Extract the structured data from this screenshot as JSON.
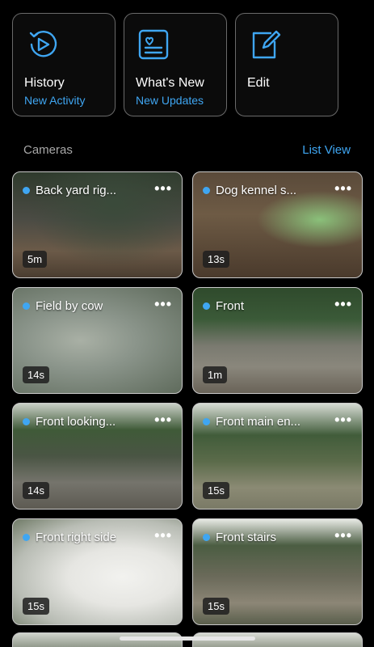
{
  "tiles": [
    {
      "title": "History",
      "subtitle": "New Activity",
      "icon": "history-play-icon"
    },
    {
      "title": "What's New",
      "subtitle": "New Updates",
      "icon": "news-card-icon"
    },
    {
      "title": "Edit",
      "subtitle": "",
      "icon": "edit-pencil-icon"
    }
  ],
  "section": {
    "title": "Cameras",
    "link": "List View"
  },
  "cameras": [
    {
      "name": "Back yard rig...",
      "age": "5m"
    },
    {
      "name": "Dog kennel s...",
      "age": "13s"
    },
    {
      "name": "Field by cow",
      "age": "14s"
    },
    {
      "name": "Front",
      "age": "1m"
    },
    {
      "name": "Front looking...",
      "age": "14s"
    },
    {
      "name": "Front main en...",
      "age": "15s"
    },
    {
      "name": "Front right side",
      "age": "15s"
    },
    {
      "name": "Front stairs",
      "age": "15s"
    }
  ],
  "colors": {
    "accent": "#3fa6f2",
    "background": "#000000"
  },
  "more_glyph": "•••"
}
